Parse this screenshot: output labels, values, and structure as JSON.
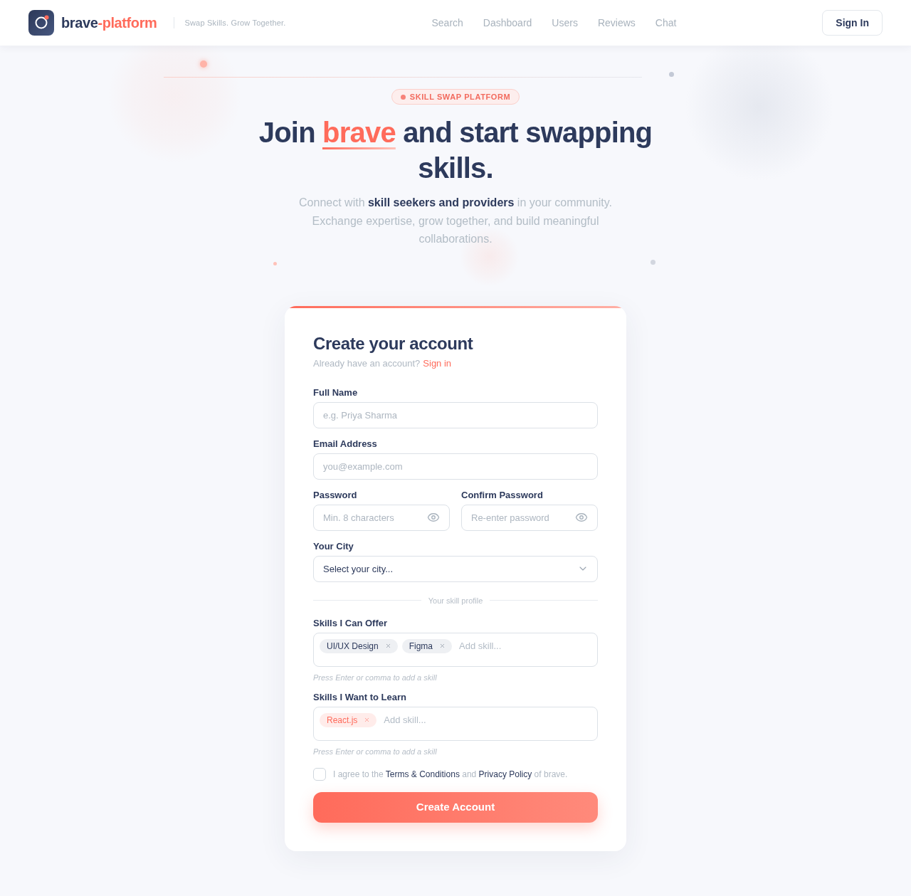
{
  "header": {
    "brand": {
      "name": "brave",
      "suffix": "-platform"
    },
    "tagline": "Swap Skills. Grow Together.",
    "nav": [
      {
        "label": "Search"
      },
      {
        "label": "Dashboard"
      },
      {
        "label": "Users"
      },
      {
        "label": "Reviews"
      },
      {
        "label": "Chat"
      }
    ],
    "sign_in": "Sign In"
  },
  "hero": {
    "badge": "SKILL SWAP PLATFORM",
    "heading": [
      {
        "text": "Join ",
        "highlight": false
      },
      {
        "text": "brave",
        "highlight": true
      },
      {
        "text": " and start swapping skills.",
        "highlight": false
      }
    ],
    "subtitle": "Connect with **skill seekers and providers** in your community. Exchange expertise, grow together, and build meaningful collaborations."
  },
  "form": {
    "title": "Create your account",
    "prompt": "Already have an account?",
    "prompt_link": "Sign in",
    "rows": [
      {
        "fields": [
          {
            "kind": "text",
            "label": "Full Name",
            "placeholder": "e.g. Priya Sharma"
          }
        ]
      },
      {
        "fields": [
          {
            "kind": "text",
            "label": "Email Address",
            "placeholder": "you@example.com"
          }
        ]
      },
      {
        "fields": [
          {
            "kind": "password",
            "label": "Password",
            "placeholder": "Min. 8 characters"
          },
          {
            "kind": "password",
            "label": "Confirm Password",
            "placeholder": "Re-enter password"
          }
        ]
      },
      {
        "fields": [
          {
            "kind": "select",
            "label": "Your City",
            "value": "Select your city..."
          }
        ]
      }
    ],
    "divider": "Your skill profile",
    "skill_groups": [
      {
        "kind": "offer",
        "label": "Skills I Can Offer",
        "tags": [
          {
            "text": "UI/UX Design"
          },
          {
            "text": "Figma"
          }
        ],
        "placeholder": "Add skill...",
        "hint": "Press Enter or comma to add a skill"
      },
      {
        "kind": "learn",
        "label": "Skills I Want to Learn",
        "tags": [
          {
            "text": "React.js"
          }
        ],
        "placeholder": "Add skill...",
        "hint": "Press Enter or comma to add a skill"
      }
    ],
    "agreement": {
      "checked": false,
      "parts": [
        {
          "kind": "text",
          "text": "I agree to the "
        },
        {
          "kind": "link",
          "text": "Terms & Conditions"
        },
        {
          "kind": "text",
          "text": " and "
        },
        {
          "kind": "link",
          "text": "Privacy Policy"
        },
        {
          "kind": "text",
          "text": " of brave."
        }
      ]
    },
    "submit": "Create Account"
  }
}
